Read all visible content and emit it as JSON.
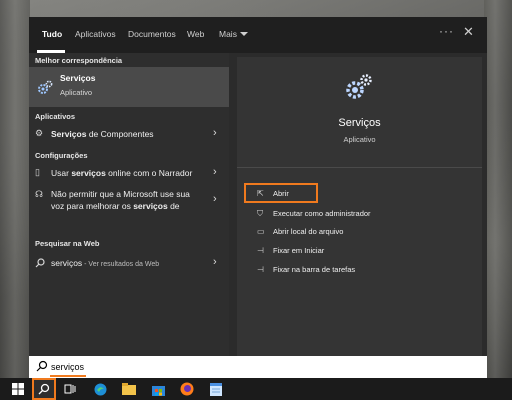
{
  "tabs": {
    "all": "Tudo",
    "apps": "Aplicativos",
    "documents": "Documentos",
    "web": "Web",
    "more": "Mais"
  },
  "left": {
    "best_match_header": "Melhor correspondência",
    "best_match": {
      "title": "Serviços",
      "subtitle": "Aplicativo"
    },
    "apps_header": "Aplicativos",
    "apps_item": {
      "bold": "Serviços",
      "rest": " de Componentes"
    },
    "settings_header": "Configurações",
    "setting_1": {
      "pre": "Usar ",
      "bold": "serviços",
      "post": " online com o Narrador"
    },
    "setting_2": {
      "line1": "Não permitir que a Microsoft use sua",
      "line2_pre": "voz para melhorar os ",
      "line2_bold": "serviços",
      "line2_post": " de"
    },
    "web_header": "Pesquisar na Web",
    "web_item": {
      "term": "serviços",
      "suffix": " - Ver resultados da Web"
    }
  },
  "right": {
    "title": "Serviços",
    "subtitle": "Aplicativo",
    "actions": [
      "Abrir",
      "Executar como administrador",
      "Abrir local do arquivo",
      "Fixar em Iniciar",
      "Fixar na barra de tarefas"
    ]
  },
  "search": {
    "value": "serviços"
  },
  "colors": {
    "accent": "#f07a1e",
    "menu_bg": "#2b2b2b",
    "selected_bg": "#4a4a4a"
  },
  "icons": [
    "gear-icon",
    "chevron-right-icon",
    "search-icon",
    "windows-icon",
    "task-view-icon",
    "edge-icon",
    "file-explorer-icon",
    "store-icon",
    "firefox-icon",
    "notepad-icon"
  ]
}
